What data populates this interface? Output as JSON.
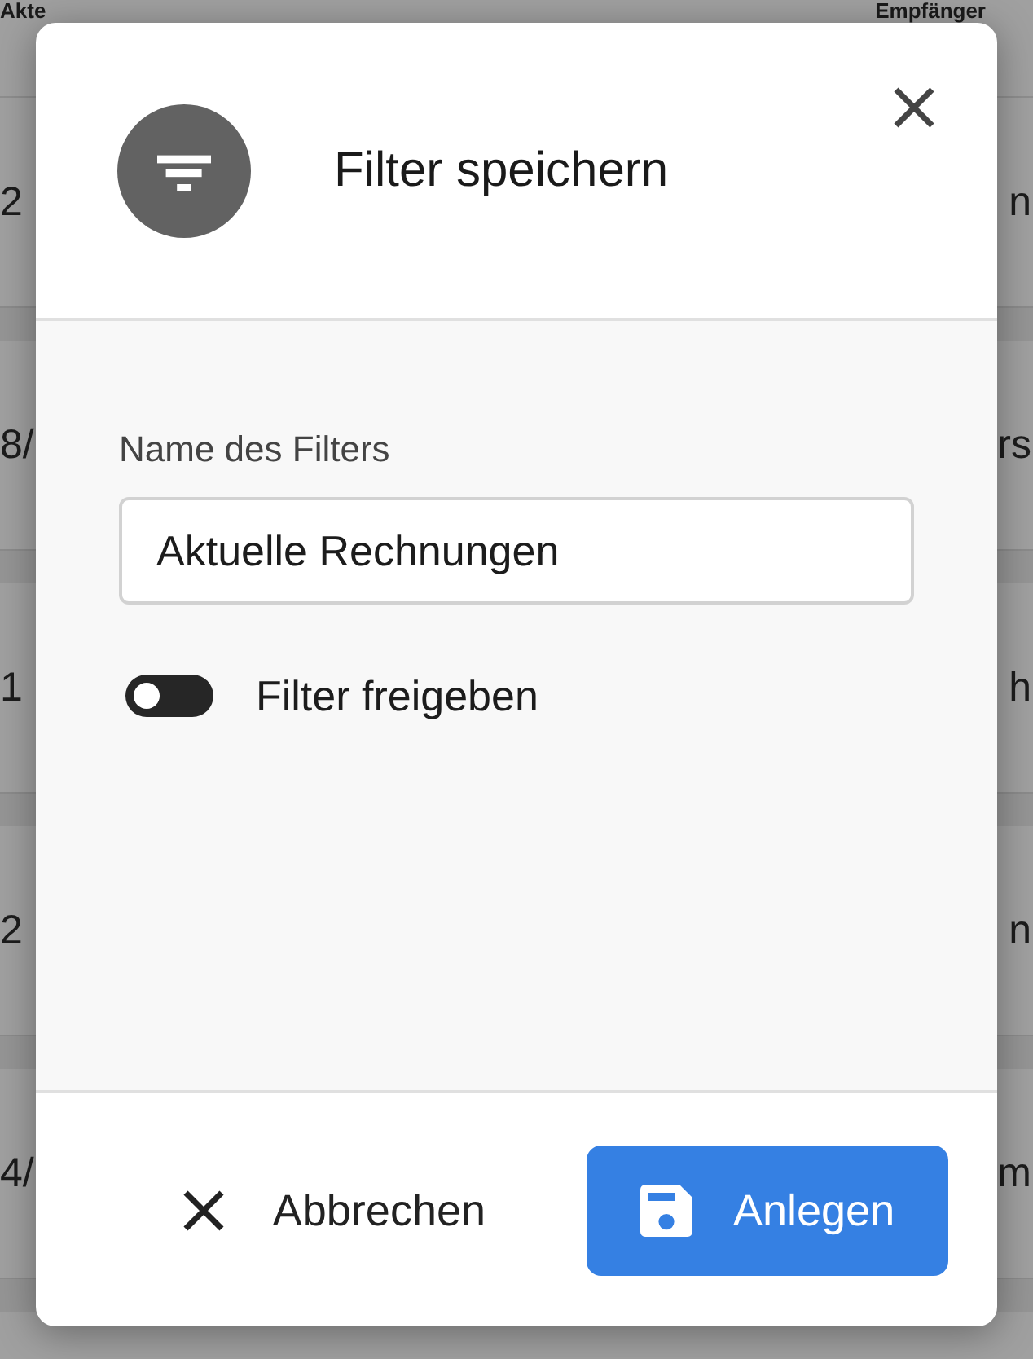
{
  "background_table": {
    "columns": [
      "Akte",
      "Empfänger"
    ],
    "rows": [
      [
        "2",
        "n"
      ],
      [
        "8/",
        "rs"
      ],
      [
        "1",
        "h"
      ],
      [
        "2",
        "n"
      ],
      [
        "4/",
        "m"
      ]
    ]
  },
  "dialog": {
    "title": "Filter speichern",
    "name_field": {
      "label": "Name des Filters",
      "value": "Aktuelle Rechnungen"
    },
    "share_toggle": {
      "label": "Filter freigeben",
      "on": false
    },
    "buttons": [
      {
        "kind": "cancel",
        "label": "Abbrechen"
      },
      {
        "kind": "save",
        "label": "Anlegen"
      }
    ]
  }
}
